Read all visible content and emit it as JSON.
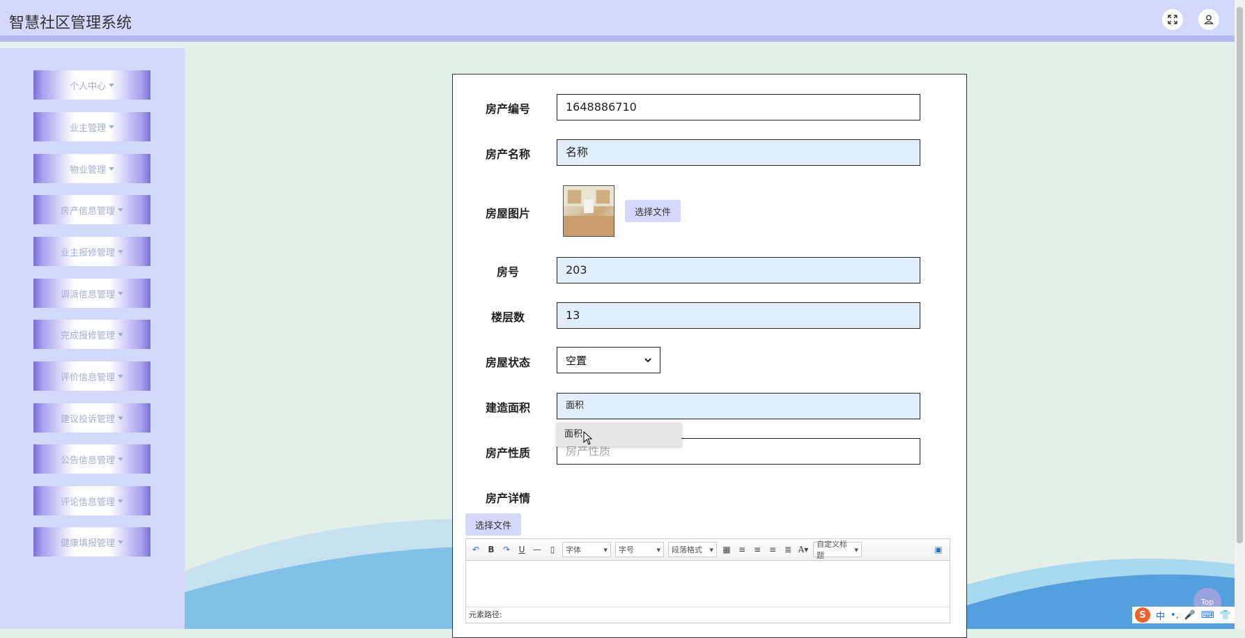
{
  "app": {
    "title": "智慧社区管理系统"
  },
  "header": {
    "fullscreen_icon": "expand-icon",
    "user_icon": "user-icon"
  },
  "sidebar": {
    "items": [
      {
        "label": "个人中心"
      },
      {
        "label": "业主管理"
      },
      {
        "label": "物业管理"
      },
      {
        "label": "房产信息管理"
      },
      {
        "label": "业主报修管理"
      },
      {
        "label": "调派信息管理"
      },
      {
        "label": "完成报修管理"
      },
      {
        "label": "评价信息管理"
      },
      {
        "label": "建议投诉管理"
      },
      {
        "label": "公告信息管理"
      },
      {
        "label": "评论信息管理"
      },
      {
        "label": "健康填报管理"
      }
    ]
  },
  "form": {
    "code": {
      "label": "房产编号",
      "value": "1648886710"
    },
    "name": {
      "label": "房产名称",
      "value": "名称"
    },
    "image": {
      "label": "房屋图片",
      "button": "选择文件"
    },
    "room": {
      "label": "房号",
      "value": "203"
    },
    "floors": {
      "label": "楼层数",
      "value": "13"
    },
    "status": {
      "label": "房屋状态",
      "value": "空置"
    },
    "area": {
      "label": "建造面积",
      "value": "面积",
      "suggestion": "面积"
    },
    "nature": {
      "label": "房产性质",
      "placeholder": "房产性质"
    },
    "detail": {
      "label": "房产详情",
      "button": "选择文件"
    }
  },
  "editor": {
    "font": "字体",
    "size": "字号",
    "paragraph": "段落格式",
    "custom": "自定义标题",
    "path_label": "元素路径:"
  },
  "misc": {
    "top_label": "Top",
    "ime_text": "中"
  },
  "colors": {
    "header_bg": "#d4d8fb",
    "field_bg": "#e3eefb",
    "accent": "#7b6fd6"
  }
}
